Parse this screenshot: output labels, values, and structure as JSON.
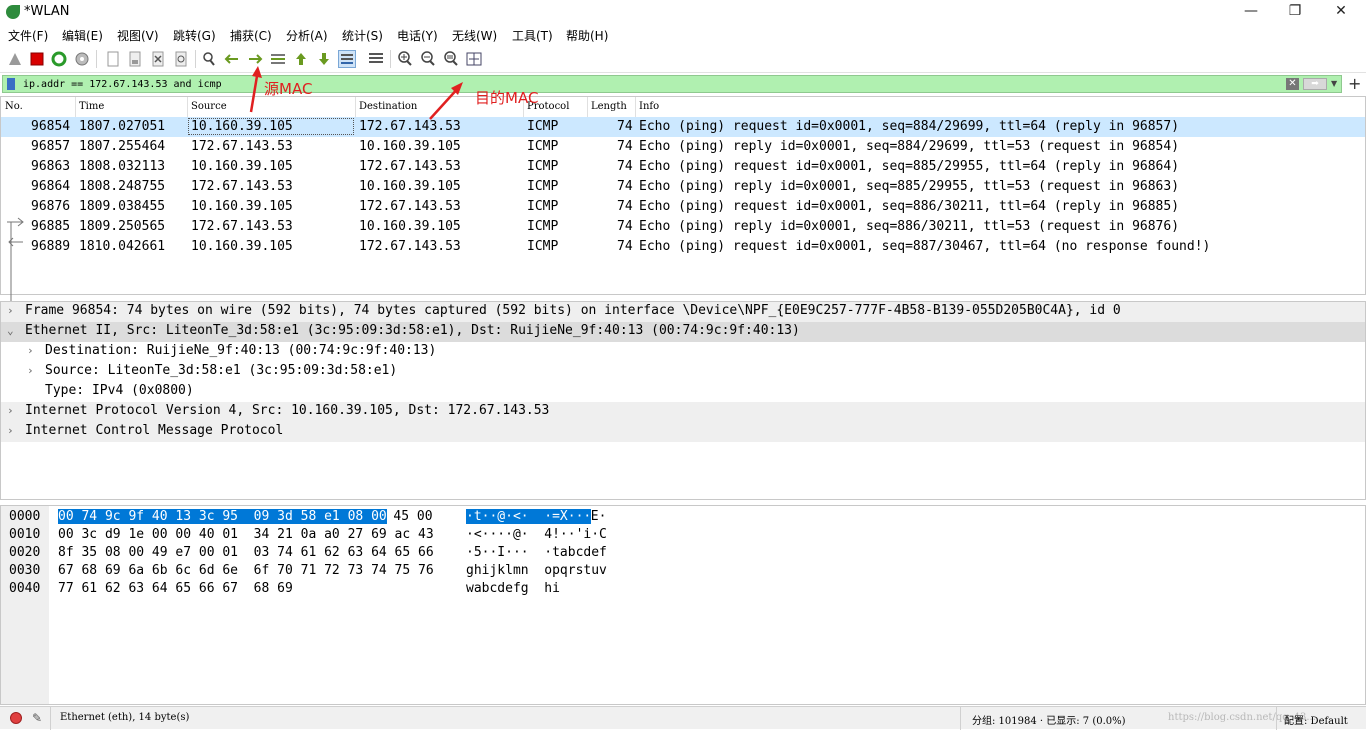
{
  "window": {
    "title": "*WLAN",
    "min_glyph": "—",
    "max_glyph": "❐",
    "close_glyph": "✕"
  },
  "menu": [
    "文件(F)",
    "编辑(E)",
    "视图(V)",
    "跳转(G)",
    "捕获(C)",
    "分析(A)",
    "统计(S)",
    "电话(Y)",
    "无线(W)",
    "工具(T)",
    "帮助(H)"
  ],
  "toolbar_icons": [
    "shark-fin-start-icon",
    "stop-icon",
    "restart-icon",
    "options-gear-icon",
    "open-file-icon",
    "save-file-icon",
    "close-file-icon",
    "reload-icon",
    "find-icon",
    "back-icon",
    "forward-icon",
    "goto-packet-icon",
    "first-packet-icon",
    "last-packet-icon",
    "autoscroll-icon",
    "colorize-icon",
    "zoom-in-icon",
    "zoom-out-icon",
    "normal-size-icon",
    "resize-columns-icon"
  ],
  "filter": {
    "value": "ip.addr == 172.67.143.53 and icmp"
  },
  "columns": [
    "No.",
    "Time",
    "Source",
    "Destination",
    "Protocol",
    "Length",
    "Info"
  ],
  "packets": [
    {
      "no": "96854",
      "time": "1807.027051",
      "src": "10.160.39.105",
      "dst": "172.67.143.53",
      "proto": "ICMP",
      "len": "74",
      "info": "Echo (ping) request  id=0x0001, seq=884/29699, ttl=64 (reply in 96857)"
    },
    {
      "no": "96857",
      "time": "1807.255464",
      "src": "172.67.143.53",
      "dst": "10.160.39.105",
      "proto": "ICMP",
      "len": "74",
      "info": "Echo (ping) reply    id=0x0001, seq=884/29699, ttl=53 (request in 96854)"
    },
    {
      "no": "96863",
      "time": "1808.032113",
      "src": "10.160.39.105",
      "dst": "172.67.143.53",
      "proto": "ICMP",
      "len": "74",
      "info": "Echo (ping) request  id=0x0001, seq=885/29955, ttl=64 (reply in 96864)"
    },
    {
      "no": "96864",
      "time": "1808.248755",
      "src": "172.67.143.53",
      "dst": "10.160.39.105",
      "proto": "ICMP",
      "len": "74",
      "info": "Echo (ping) reply    id=0x0001, seq=885/29955, ttl=53 (request in 96863)"
    },
    {
      "no": "96876",
      "time": "1809.038455",
      "src": "10.160.39.105",
      "dst": "172.67.143.53",
      "proto": "ICMP",
      "len": "74",
      "info": "Echo (ping) request  id=0x0001, seq=886/30211, ttl=64 (reply in 96885)"
    },
    {
      "no": "96885",
      "time": "1809.250565",
      "src": "172.67.143.53",
      "dst": "10.160.39.105",
      "proto": "ICMP",
      "len": "74",
      "info": "Echo (ping) reply    id=0x0001, seq=886/30211, ttl=53 (request in 96876)"
    },
    {
      "no": "96889",
      "time": "1810.042661",
      "src": "10.160.39.105",
      "dst": "172.67.143.53",
      "proto": "ICMP",
      "len": "74",
      "info": "Echo (ping) request  id=0x0001, seq=887/30467, ttl=64 (no response found!)"
    }
  ],
  "details": [
    {
      "text": "Frame 96854: 74 bytes on wire (592 bits), 74 bytes captured (592 bits) on interface \\Device\\NPF_{E0E9C257-777F-4B58-B139-055D205B0C4A}, id 0",
      "arrow": "›"
    },
    {
      "text": "Ethernet II, Src: LiteonTe_3d:58:e1 (3c:95:09:3d:58:e1), Dst: RuijieNe_9f:40:13 (00:74:9c:9f:40:13)",
      "arrow": "⌄"
    },
    {
      "text": "Destination: RuijieNe_9f:40:13 (00:74:9c:9f:40:13)",
      "arrow": "›"
    },
    {
      "text": "Source: LiteonTe_3d:58:e1 (3c:95:09:3d:58:e1)",
      "arrow": "›"
    },
    {
      "text": "Type: IPv4 (0x0800)",
      "arrow": ""
    },
    {
      "text": "Internet Protocol Version 4, Src: 10.160.39.105, Dst: 172.67.143.53",
      "arrow": "›"
    },
    {
      "text": "Internet Control Message Protocol",
      "arrow": "›"
    }
  ],
  "bytes": [
    {
      "offset": "0000",
      "hex_sel": "00 74 9c 9f 40 13 3c 95  09 3d 58 e1 08 00",
      "hex_rest": " 45 00",
      "ascii_sel": "·t··@·<·  ·=X···",
      "ascii_rest": "E·"
    },
    {
      "offset": "0010",
      "hex_sel": "",
      "hex_rest": "00 3c d9 1e 00 00 40 01  34 21 0a a0 27 69 ac 43",
      "ascii_sel": "",
      "ascii_rest": "·<····@·  4!··'i·C"
    },
    {
      "offset": "0020",
      "hex_sel": "",
      "hex_rest": "8f 35 08 00 49 e7 00 01  03 74 61 62 63 64 65 66",
      "ascii_sel": "",
      "ascii_rest": "·5··I···  ·tabcdef"
    },
    {
      "offset": "0030",
      "hex_sel": "",
      "hex_rest": "67 68 69 6a 6b 6c 6d 6e  6f 70 71 72 73 74 75 76",
      "ascii_sel": "",
      "ascii_rest": "ghijklmn  opqrstuv"
    },
    {
      "offset": "0040",
      "hex_sel": "",
      "hex_rest": "77 61 62 63 64 65 66 67  68 69",
      "ascii_sel": "",
      "ascii_rest": "wabcdefg  hi"
    }
  ],
  "status": {
    "field": "Ethernet (eth), 14 byte(s)",
    "packets": "分组: 101984 · 已显示: 7 (0.0%)",
    "profile": "配置: Default",
    "watermark": "https://blog.csdn.net/qq_43..."
  },
  "annotations": {
    "src_mac": "源MAC",
    "dst_mac": "目的MAC"
  },
  "colors": {
    "filter_bg": "#b0f0b0",
    "selected_row": "#cce8ff",
    "byte_selection": "#0078d7",
    "annotation": "#e02020"
  }
}
